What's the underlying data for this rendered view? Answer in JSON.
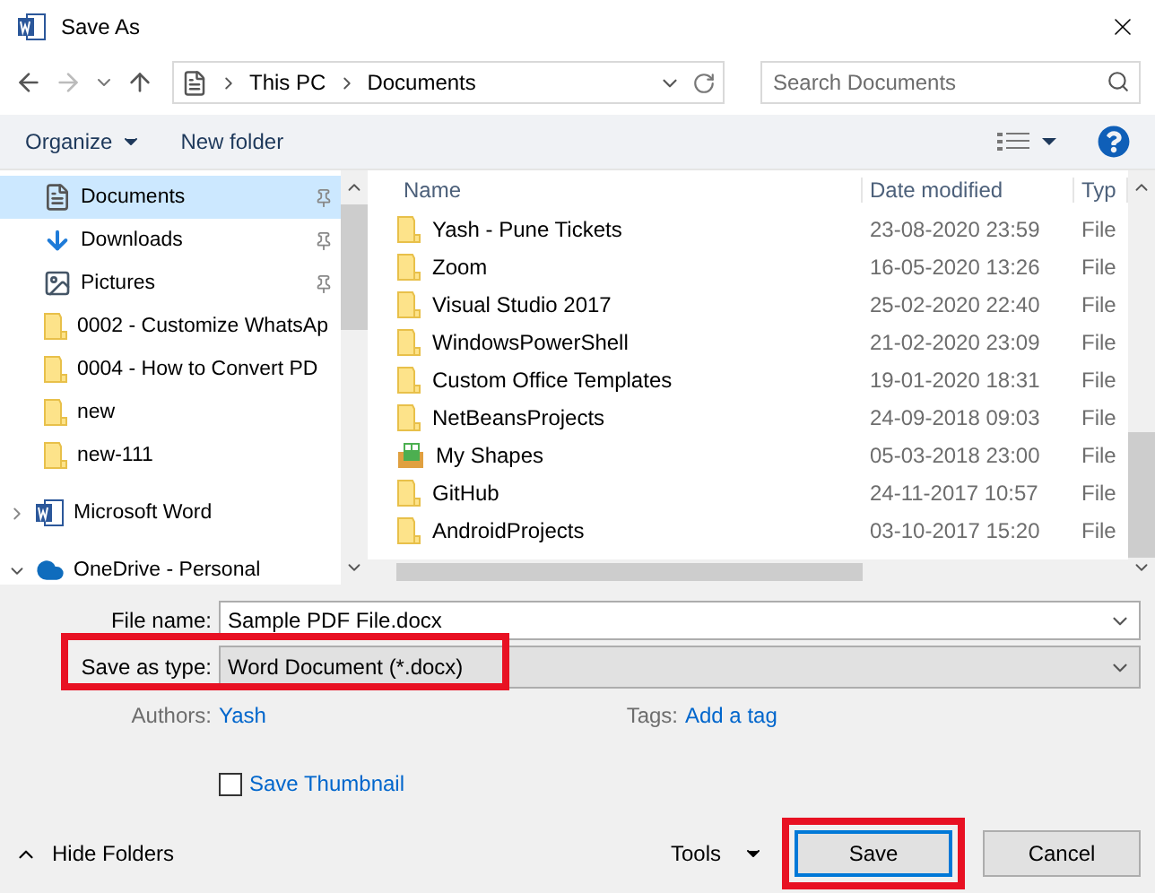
{
  "window": {
    "title": "Save As"
  },
  "address": {
    "path": [
      "This PC",
      "Documents"
    ],
    "search_placeholder": "Search Documents"
  },
  "toolbar": {
    "organize": "Organize",
    "new_folder": "New folder"
  },
  "sidebar": {
    "items": [
      {
        "label": "Documents",
        "kind": "documents",
        "pinned": true,
        "selected": true
      },
      {
        "label": "Downloads",
        "kind": "downloads",
        "pinned": true,
        "selected": false
      },
      {
        "label": "Pictures",
        "kind": "pictures",
        "pinned": true,
        "selected": false
      },
      {
        "label": "0002 - Customize WhatsAp",
        "kind": "folder",
        "pinned": false,
        "selected": false
      },
      {
        "label": "0004 - How to Convert PD",
        "kind": "folder",
        "pinned": false,
        "selected": false
      },
      {
        "label": "new",
        "kind": "folder",
        "pinned": false,
        "selected": false
      },
      {
        "label": "new-111",
        "kind": "folder",
        "pinned": false,
        "selected": false
      },
      {
        "label": "Microsoft Word",
        "kind": "word",
        "expanded": false,
        "selected": false
      },
      {
        "label": "OneDrive - Personal",
        "kind": "cloud",
        "expanded": true,
        "selected": false
      }
    ]
  },
  "table": {
    "columns": [
      "Name",
      "Date modified",
      "Typ"
    ],
    "rows": [
      {
        "name": "Yash - Pune Tickets",
        "kind": "folder",
        "date": "23-08-2020 23:59",
        "type": "File"
      },
      {
        "name": "Zoom",
        "kind": "folder",
        "date": "16-05-2020 13:26",
        "type": "File"
      },
      {
        "name": "Visual Studio 2017",
        "kind": "folder",
        "date": "25-02-2020 22:40",
        "type": "File"
      },
      {
        "name": "WindowsPowerShell",
        "kind": "folder",
        "date": "21-02-2020 23:09",
        "type": "File"
      },
      {
        "name": "Custom Office Templates",
        "kind": "folder",
        "date": "19-01-2020 18:31",
        "type": "File"
      },
      {
        "name": "NetBeansProjects",
        "kind": "folder",
        "date": "24-09-2018 09:03",
        "type": "File"
      },
      {
        "name": "My Shapes",
        "kind": "shapes",
        "date": "05-03-2018 23:00",
        "type": "File"
      },
      {
        "name": "GitHub",
        "kind": "folder",
        "date": "24-11-2017 10:57",
        "type": "File"
      },
      {
        "name": "AndroidProjects",
        "kind": "folder",
        "date": "03-10-2017 15:20",
        "type": "File"
      }
    ]
  },
  "form": {
    "file_name_label": "File name:",
    "file_name": "Sample PDF File.docx",
    "type_label": "Save as type:",
    "type_value": "Word Document (*.docx)",
    "authors_label": "Authors:",
    "authors": "Yash",
    "tags_label": "Tags:",
    "tags": "Add a tag",
    "thumbnail_label": "Save Thumbnail",
    "thumbnail_checked": false,
    "type_highlighted": true
  },
  "footer": {
    "hide_folders": "Hide Folders",
    "tools": "Tools",
    "save": "Save",
    "cancel": "Cancel",
    "save_highlighted": true
  }
}
